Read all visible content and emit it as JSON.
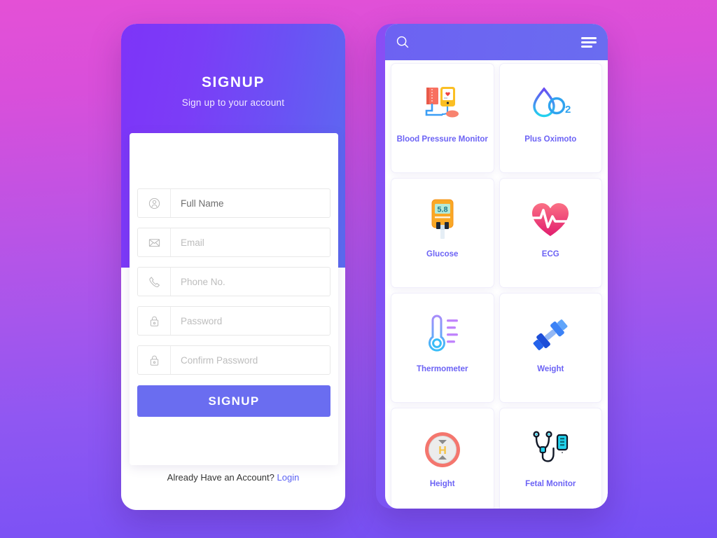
{
  "background": {
    "gradient_from": "#e450d6",
    "gradient_to": "#7550f5"
  },
  "signup_screen": {
    "title": "SIGNUP",
    "subtitle": "Sign up to your account",
    "header_gradient_from": "#7d34f8",
    "header_gradient_to": "#5a6cf0",
    "fields": [
      {
        "icon": "user-icon",
        "name": "full-name",
        "value": "Full Name",
        "placeholder": "Full Name",
        "filled": true
      },
      {
        "icon": "mail-icon",
        "name": "email",
        "value": "Email",
        "placeholder": "Email",
        "filled": false
      },
      {
        "icon": "phone-icon",
        "name": "phone",
        "value": "Phone No.",
        "placeholder": "Phone No.",
        "filled": false
      },
      {
        "icon": "lock-icon",
        "name": "password",
        "value": "Password",
        "placeholder": "Password",
        "filled": false
      },
      {
        "icon": "lock-icon",
        "name": "confirm-password",
        "value": "Confirm Password",
        "placeholder": "Confirm Password",
        "filled": false
      }
    ],
    "submit_label": "SIGNUP",
    "submit_color": "#6a6df0",
    "footer_text": "Already Have an Account?",
    "footer_link": "Login",
    "footer_link_color": "#5b62f4"
  },
  "devices_screen": {
    "header_color": "#6a6cf0",
    "search_icon": "search-icon",
    "menu_icon": "hamburger-menu-icon",
    "label_color": "#6c63f5",
    "cards": [
      {
        "label": "Blood Pressure Monitor",
        "icon": "blood-pressure-monitor-icon"
      },
      {
        "label": "Plus Oximoto",
        "icon": "oxygen-drop-o2-icon"
      },
      {
        "label": "Glucose",
        "icon": "glucose-meter-icon",
        "reading": "5.8"
      },
      {
        "label": "ECG",
        "icon": "heart-ecg-icon"
      },
      {
        "label": "Thermometer",
        "icon": "thermometer-icon"
      },
      {
        "label": "Weight",
        "icon": "dumbbell-weight-icon"
      },
      {
        "label": "Height",
        "icon": "height-gauge-icon",
        "glyph": "H"
      },
      {
        "label": "Fetal Monitor",
        "icon": "stethoscope-fetal-monitor-icon"
      }
    ]
  }
}
